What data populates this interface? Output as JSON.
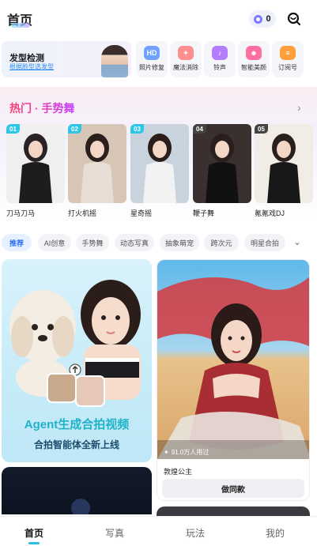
{
  "header": {
    "title": "首页",
    "coins": "0"
  },
  "feature": {
    "title": "发型检测",
    "subtitle": "根据脸型选发型"
  },
  "tools": [
    {
      "label": "照片修复",
      "icon": "photo-restore-icon",
      "badge": "HD",
      "color": "#6fa3ff"
    },
    {
      "label": "魔法消除",
      "icon": "magic-eraser-icon",
      "badge": "✦",
      "color": "#ff8f8f"
    },
    {
      "label": "铃声",
      "icon": "bell-icon",
      "badge": "♪",
      "color": "#b47cff"
    },
    {
      "label": "智能美颜",
      "icon": "beauty-icon",
      "badge": "☻",
      "color": "#ff6f9f"
    },
    {
      "label": "订阅号",
      "icon": "subscription-icon",
      "badge": "≡",
      "color": "#ff9f3c"
    }
  ],
  "hot": {
    "title": "热门 · 手势舞",
    "items": [
      {
        "num": "01",
        "label": "刀马刀马",
        "numColor": "#2ec6e6"
      },
      {
        "num": "02",
        "label": "打火机摇",
        "numColor": "#2ec6e6"
      },
      {
        "num": "03",
        "label": "星奇摇",
        "numColor": "#2ec6e6"
      },
      {
        "num": "04",
        "label": "鞭子舞",
        "numColor": "#444444"
      },
      {
        "num": "05",
        "label": "氪氪戏DJ",
        "numColor": "#444444"
      }
    ]
  },
  "chips": [
    "推荐",
    "AI创意",
    "手势舞",
    "动态写真",
    "抽象萌宠",
    "跨次元",
    "明星合拍"
  ],
  "feed": {
    "card_a": {
      "title": "Agent生成合拍视频",
      "subtitle": "合拍智能体全新上线"
    },
    "card_b": {
      "usage": "91.0万人用过",
      "title": "敦煌公主",
      "button": "做同款"
    }
  },
  "nav": [
    "首页",
    "写真",
    "玩法",
    "我的"
  ]
}
